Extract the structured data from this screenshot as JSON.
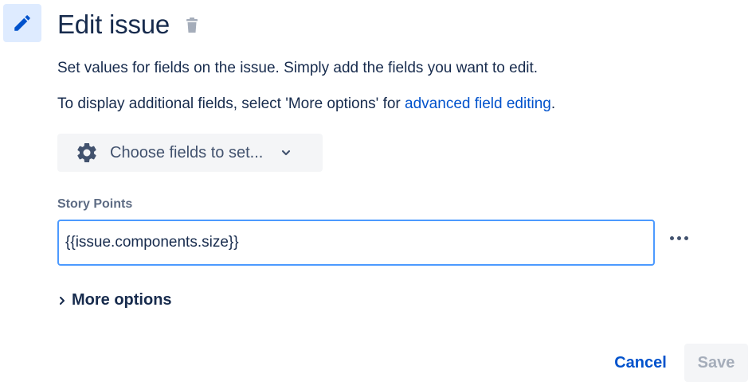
{
  "header": {
    "title": "Edit issue",
    "icon": "pencil-icon",
    "delete_icon": "trash-icon"
  },
  "description": {
    "line1": "Set values for fields on the issue. Simply add the fields you want to edit.",
    "line2_prefix": "To display additional fields, select 'More options' for ",
    "line2_link": "advanced field editing",
    "line2_suffix": "."
  },
  "choose_fields": {
    "label": "Choose fields to set...",
    "icon": "gear-icon",
    "dropdown_icon": "chevron-down-icon"
  },
  "story_points": {
    "label": "Story Points",
    "value": "{{issue.components.size}}"
  },
  "more_options": {
    "label": "More options",
    "icon": "chevron-right-icon"
  },
  "footer": {
    "cancel_label": "Cancel",
    "save_label": "Save"
  },
  "colors": {
    "accent": "#0052cc",
    "focus_border": "#4c9aff",
    "icon_bg": "#deebff"
  }
}
